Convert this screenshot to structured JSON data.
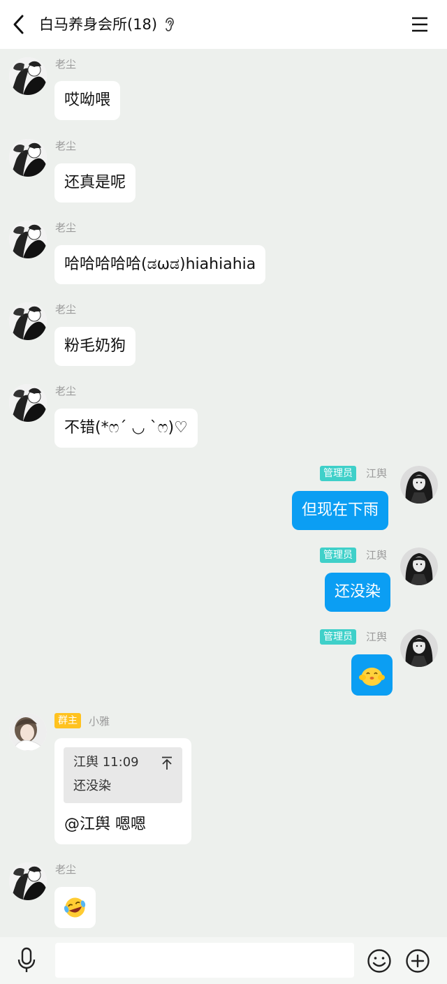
{
  "header": {
    "title": "白马养身会所(18)"
  },
  "messages": [
    {
      "sender": "老尘",
      "text": "哎呦喂"
    },
    {
      "sender": "老尘",
      "text": "还真是呢"
    },
    {
      "sender": "老尘",
      "text": "哈哈哈哈哈(ಡωಡ)hiahiahia"
    },
    {
      "sender": "老尘",
      "text": "粉毛奶狗"
    },
    {
      "sender": "老尘",
      "text": "不错(*ෆ´ ◡ `ෆ)♡"
    },
    {
      "sender": "江舆",
      "role": "管理员",
      "text": "但现在下雨"
    },
    {
      "sender": "江舆",
      "role": "管理员",
      "text": "还没染"
    },
    {
      "sender": "江舆",
      "role": "管理员",
      "sticker": "hug-sticker"
    },
    {
      "sender": "小雅",
      "role": "群主",
      "quote": {
        "head": "江舆 11:09",
        "text": "还没染"
      },
      "text": "@江舆 嗯嗯"
    },
    {
      "sender": "老尘",
      "sticker": "laughing-tears-sticker"
    }
  ],
  "input": {
    "placeholder": ""
  },
  "colors": {
    "background": "#edf0ed",
    "my_bubble": "#0b9ef3",
    "admin_badge": "#3fd0c9",
    "owner_badge": "#ffc21f"
  },
  "icons": [
    "back-icon",
    "ear-icon",
    "menu-icon",
    "mic-icon",
    "emoji-icon",
    "plus-icon"
  ]
}
